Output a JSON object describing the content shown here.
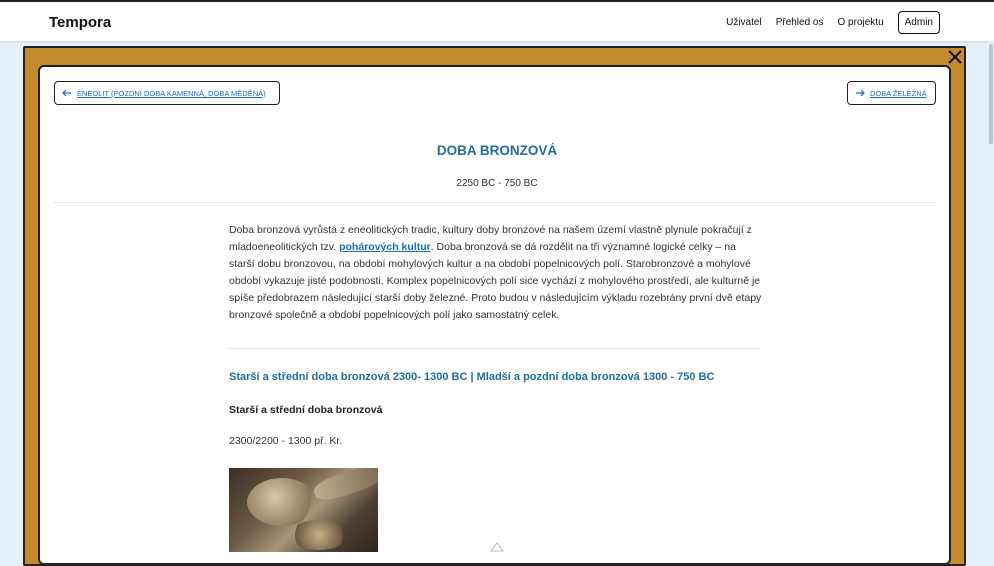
{
  "header": {
    "brand": "Tempora",
    "nav": [
      {
        "label": "Uživatel"
      },
      {
        "label": "Přehled os"
      },
      {
        "label": "O projektu"
      }
    ],
    "admin_label": "Admin"
  },
  "modal": {
    "close_icon": "close-icon",
    "prev": {
      "label": "Eneolit (pozdní doba kamenná, doba měděná)",
      "icon": "arrow-left-icon"
    },
    "next": {
      "label": "Doba železná",
      "icon": "arrow-right-icon"
    },
    "title": "DOBA BRONZOVÁ",
    "dates": "2250 BC - 750 BC",
    "intro": {
      "before_link": "Doba bronzová vyrůstá z eneolitických tradic, kultury doby bronzové na našem území vlastně plynule pokračují z mladoeneolitických tzv. ",
      "link": "pohárových kultur",
      "after_link": ". Doba bronzová se dá rozdělit na tři významné logické celky – na starší dobu bronzovou, na období mohylových kultur a na období popelnicových polí. Starobronzové a mohylové období vykazuje jisté podobnosti. Komplex popelnicových polí sice vychází z mohylového prostředí, ale kulturně je spíše předobrazem následující starší doby železné. Proto budou v následujícím výkladu rozebrány první dvě etapy bronzové společně a období popelnicových polí jako samostatný celek."
    },
    "subnav": {
      "part1": "Starší a střední doba bronzová 2300- 1300 BC",
      "separator": " | ",
      "part2": "Mladší a pozdní doba bronzová 1300 - 750 BC"
    },
    "section": {
      "heading": "Starší a střední doba bronzová",
      "dates": "2300/2200 - 1300 př. Kr."
    }
  }
}
